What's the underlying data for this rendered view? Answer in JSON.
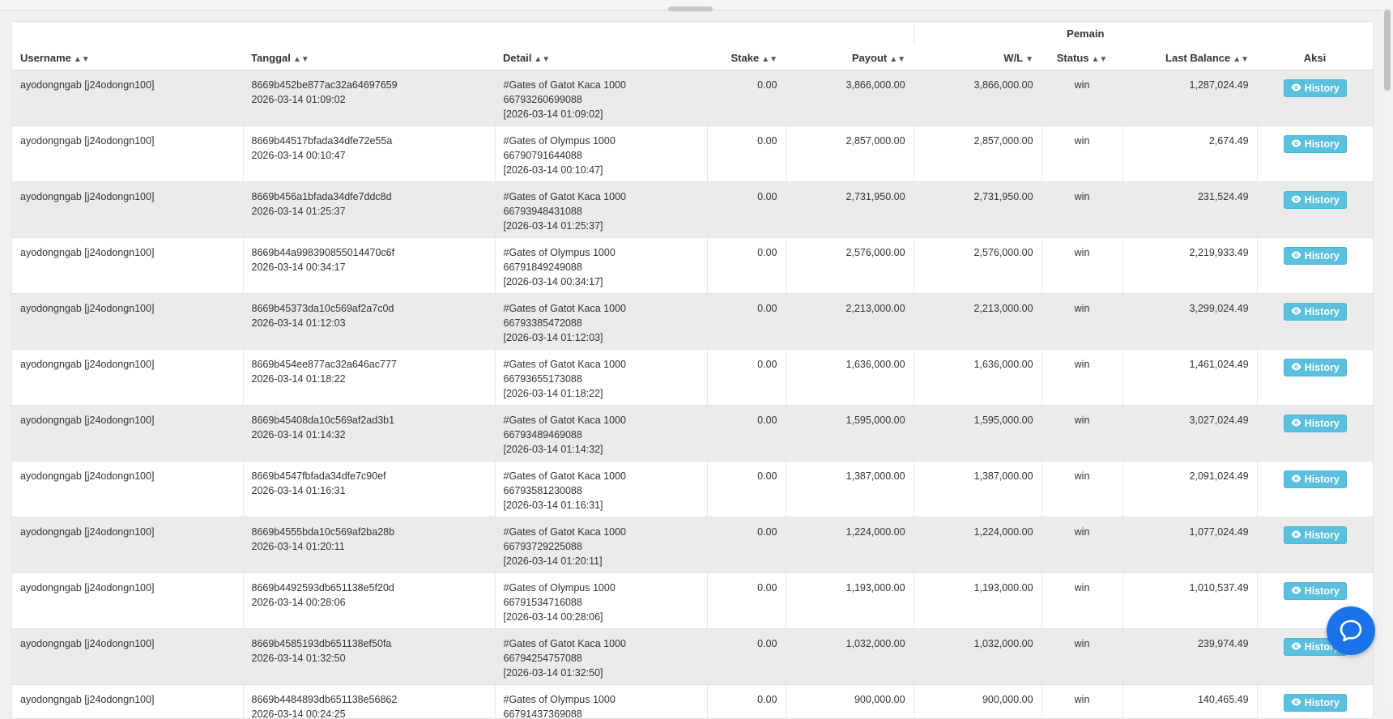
{
  "table": {
    "group_header": "Pemain",
    "columns": {
      "username": "Username",
      "tanggal": "Tanggal",
      "detail": "Detail",
      "stake": "Stake",
      "payout": "Payout",
      "wl": "W/L",
      "status": "Status",
      "last_balance": "Last Balance",
      "aksi": "Aksi"
    },
    "sort_icons": {
      "both": "▲▼",
      "desc": "▼"
    },
    "history_label": "History",
    "history_icon": "eye-icon",
    "rows": [
      {
        "username": "ayodongngab [j24odongn100]",
        "tx": "8669b452be877ac32a64697659",
        "date": "2026-03-14 01:09:02",
        "game": "#Gates of Gatot Kaca 1000",
        "round": "66793260699088",
        "round_time": "[2026-03-14 01:09:02]",
        "stake": "0.00",
        "payout": "3,866,000.00",
        "wl": "3,866,000.00",
        "status": "win",
        "last_balance": "1,287,024.49"
      },
      {
        "username": "ayodongngab [j24odongn100]",
        "tx": "8669b44517bfada34dfe72e55a",
        "date": "2026-03-14 00:10:47",
        "game": "#Gates of Olympus 1000",
        "round": "66790791644088",
        "round_time": "[2026-03-14 00:10:47]",
        "stake": "0.00",
        "payout": "2,857,000.00",
        "wl": "2,857,000.00",
        "status": "win",
        "last_balance": "2,674.49"
      },
      {
        "username": "ayodongngab [j24odongn100]",
        "tx": "8669b456a1bfada34dfe7ddc8d",
        "date": "2026-03-14 01:25:37",
        "game": "#Gates of Gatot Kaca 1000",
        "round": "66793948431088",
        "round_time": "[2026-03-14 01:25:37]",
        "stake": "0.00",
        "payout": "2,731,950.00",
        "wl": "2,731,950.00",
        "status": "win",
        "last_balance": "231,524.49"
      },
      {
        "username": "ayodongngab [j24odongn100]",
        "tx": "8669b44a998390855014470c6f",
        "date": "2026-03-14 00:34:17",
        "game": "#Gates of Olympus 1000",
        "round": "66791849249088",
        "round_time": "[2026-03-14 00:34:17]",
        "stake": "0.00",
        "payout": "2,576,000.00",
        "wl": "2,576,000.00",
        "status": "win",
        "last_balance": "2,219,933.49"
      },
      {
        "username": "ayodongngab [j24odongn100]",
        "tx": "8669b45373da10c569af2a7c0d",
        "date": "2026-03-14 01:12:03",
        "game": "#Gates of Gatot Kaca 1000",
        "round": "66793385472088",
        "round_time": "[2026-03-14 01:12:03]",
        "stake": "0.00",
        "payout": "2,213,000.00",
        "wl": "2,213,000.00",
        "status": "win",
        "last_balance": "3,299,024.49"
      },
      {
        "username": "ayodongngab [j24odongn100]",
        "tx": "8669b454ee877ac32a646ac777",
        "date": "2026-03-14 01:18:22",
        "game": "#Gates of Gatot Kaca 1000",
        "round": "66793655173088",
        "round_time": "[2026-03-14 01:18:22]",
        "stake": "0.00",
        "payout": "1,636,000.00",
        "wl": "1,636,000.00",
        "status": "win",
        "last_balance": "1,461,024.49"
      },
      {
        "username": "ayodongngab [j24odongn100]",
        "tx": "8669b45408da10c569af2ad3b1",
        "date": "2026-03-14 01:14:32",
        "game": "#Gates of Gatot Kaca 1000",
        "round": "66793489469088",
        "round_time": "[2026-03-14 01:14:32]",
        "stake": "0.00",
        "payout": "1,595,000.00",
        "wl": "1,595,000.00",
        "status": "win",
        "last_balance": "3,027,024.49"
      },
      {
        "username": "ayodongngab [j24odongn100]",
        "tx": "8669b4547fbfada34dfe7c90ef",
        "date": "2026-03-14 01:16:31",
        "game": "#Gates of Gatot Kaca 1000",
        "round": "66793581230088",
        "round_time": "[2026-03-14 01:16:31]",
        "stake": "0.00",
        "payout": "1,387,000.00",
        "wl": "1,387,000.00",
        "status": "win",
        "last_balance": "2,091,024.49"
      },
      {
        "username": "ayodongngab [j24odongn100]",
        "tx": "8669b4555bda10c569af2ba28b",
        "date": "2026-03-14 01:20:11",
        "game": "#Gates of Gatot Kaca 1000",
        "round": "66793729225088",
        "round_time": "[2026-03-14 01:20:11]",
        "stake": "0.00",
        "payout": "1,224,000.00",
        "wl": "1,224,000.00",
        "status": "win",
        "last_balance": "1,077,024.49"
      },
      {
        "username": "ayodongngab [j24odongn100]",
        "tx": "8669b4492593db651138e5f20d",
        "date": "2026-03-14 00:28:06",
        "game": "#Gates of Olympus 1000",
        "round": "66791534716088",
        "round_time": "[2026-03-14 00:28:06]",
        "stake": "0.00",
        "payout": "1,193,000.00",
        "wl": "1,193,000.00",
        "status": "win",
        "last_balance": "1,010,537.49"
      },
      {
        "username": "ayodongngab [j24odongn100]",
        "tx": "8669b4585193db651138ef50fa",
        "date": "2026-03-14 01:32:50",
        "game": "#Gates of Gatot Kaca 1000",
        "round": "66794254757088",
        "round_time": "[2026-03-14 01:32:50]",
        "stake": "0.00",
        "payout": "1,032,000.00",
        "wl": "1,032,000.00",
        "status": "win",
        "last_balance": "239,974.49"
      },
      {
        "username": "ayodongngab [j24odongn100]",
        "tx": "8669b4484893db651138e56862",
        "date": "2026-03-14 00:24:25",
        "game": "#Gates of Olympus 1000",
        "round": "66791437369088",
        "round_time": "",
        "stake": "0.00",
        "payout": "900,000.00",
        "wl": "900,000.00",
        "status": "win",
        "last_balance": "140,465.49"
      }
    ]
  },
  "chat_widget": {
    "icon": "chat-bubble-icon",
    "color": "#1a73e8"
  },
  "colors": {
    "history_button": "#5bc0de",
    "row_stripe": "#ebebeb"
  }
}
